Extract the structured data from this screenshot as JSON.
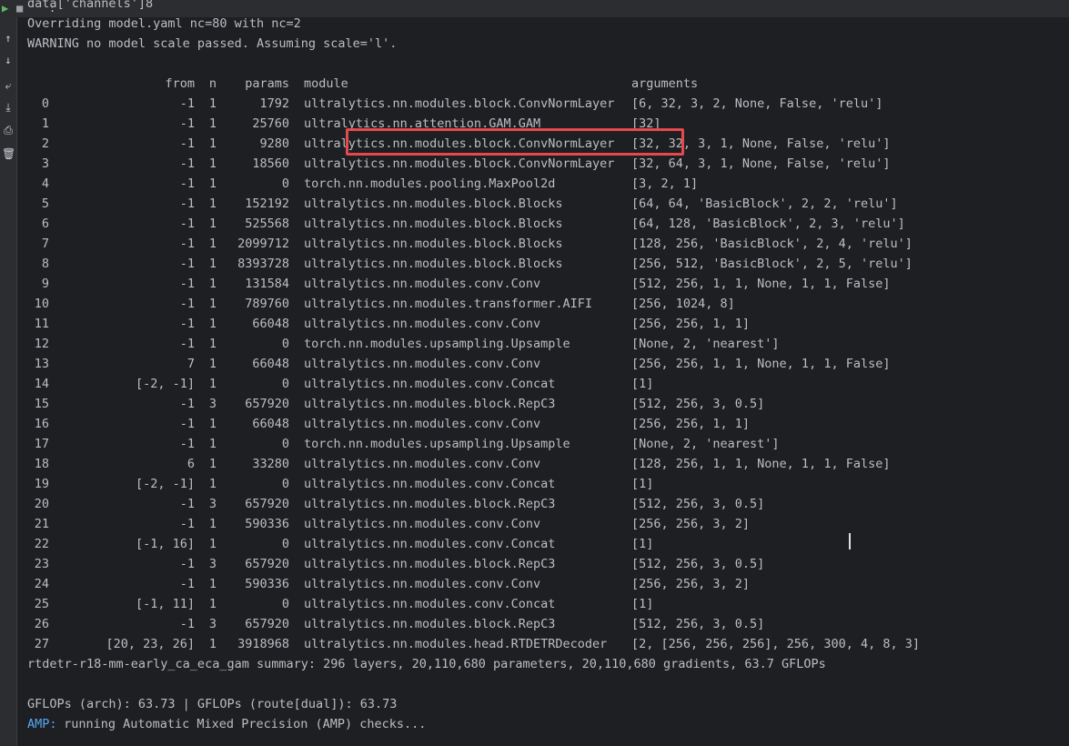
{
  "toolbar": {
    "run_icon": "run-icon",
    "stop_icon": "stop-icon",
    "menu_text": ":"
  },
  "sidebar": {
    "icons": [
      "arrow-up-icon",
      "arrow-down-icon",
      "soft-wrap-icon",
      "scroll-to-end-icon",
      "print-icon",
      "trash-icon"
    ],
    "glyphs": [
      "↑",
      "↓",
      "⤶",
      "⤓",
      "⎙",
      "🗑"
    ]
  },
  "console": {
    "pre_lines": [
      "data['channels']8",
      "Overriding model.yaml nc=80 with nc=2",
      "WARNING no model scale passed. Assuming scale='l'."
    ],
    "table_header": {
      "from": "from",
      "n": "n",
      "params": "params",
      "module": "module",
      "arguments": "arguments"
    },
    "rows": [
      {
        "idx": "0",
        "from": "-1",
        "n": "1",
        "params": "1792",
        "module": "ultralytics.nn.modules.block.ConvNormLayer",
        "arguments": "[6, 32, 3, 2, None, False, 'relu']"
      },
      {
        "idx": "1",
        "from": "-1",
        "n": "1",
        "params": "25760",
        "module": "ultralytics.nn.attention.GAM.GAM",
        "arguments": "[32]"
      },
      {
        "idx": "2",
        "from": "-1",
        "n": "1",
        "params": "9280",
        "module": "ultralytics.nn.modules.block.ConvNormLayer",
        "arguments": "[32, 32, 3, 1, None, False, 'relu']"
      },
      {
        "idx": "3",
        "from": "-1",
        "n": "1",
        "params": "18560",
        "module": "ultralytics.nn.modules.block.ConvNormLayer",
        "arguments": "[32, 64, 3, 1, None, False, 'relu']"
      },
      {
        "idx": "4",
        "from": "-1",
        "n": "1",
        "params": "0",
        "module": "torch.nn.modules.pooling.MaxPool2d",
        "arguments": "[3, 2, 1]"
      },
      {
        "idx": "5",
        "from": "-1",
        "n": "1",
        "params": "152192",
        "module": "ultralytics.nn.modules.block.Blocks",
        "arguments": "[64, 64, 'BasicBlock', 2, 2, 'relu']"
      },
      {
        "idx": "6",
        "from": "-1",
        "n": "1",
        "params": "525568",
        "module": "ultralytics.nn.modules.block.Blocks",
        "arguments": "[64, 128, 'BasicBlock', 2, 3, 'relu']"
      },
      {
        "idx": "7",
        "from": "-1",
        "n": "1",
        "params": "2099712",
        "module": "ultralytics.nn.modules.block.Blocks",
        "arguments": "[128, 256, 'BasicBlock', 2, 4, 'relu']"
      },
      {
        "idx": "8",
        "from": "-1",
        "n": "1",
        "params": "8393728",
        "module": "ultralytics.nn.modules.block.Blocks",
        "arguments": "[256, 512, 'BasicBlock', 2, 5, 'relu']"
      },
      {
        "idx": "9",
        "from": "-1",
        "n": "1",
        "params": "131584",
        "module": "ultralytics.nn.modules.conv.Conv",
        "arguments": "[512, 256, 1, 1, None, 1, 1, False]"
      },
      {
        "idx": "10",
        "from": "-1",
        "n": "1",
        "params": "789760",
        "module": "ultralytics.nn.modules.transformer.AIFI",
        "arguments": "[256, 1024, 8]"
      },
      {
        "idx": "11",
        "from": "-1",
        "n": "1",
        "params": "66048",
        "module": "ultralytics.nn.modules.conv.Conv",
        "arguments": "[256, 256, 1, 1]"
      },
      {
        "idx": "12",
        "from": "-1",
        "n": "1",
        "params": "0",
        "module": "torch.nn.modules.upsampling.Upsample",
        "arguments": "[None, 2, 'nearest']"
      },
      {
        "idx": "13",
        "from": "7",
        "n": "1",
        "params": "66048",
        "module": "ultralytics.nn.modules.conv.Conv",
        "arguments": "[256, 256, 1, 1, None, 1, 1, False]"
      },
      {
        "idx": "14",
        "from": "[-2, -1]",
        "n": "1",
        "params": "0",
        "module": "ultralytics.nn.modules.conv.Concat",
        "arguments": "[1]"
      },
      {
        "idx": "15",
        "from": "-1",
        "n": "3",
        "params": "657920",
        "module": "ultralytics.nn.modules.block.RepC3",
        "arguments": "[512, 256, 3, 0.5]"
      },
      {
        "idx": "16",
        "from": "-1",
        "n": "1",
        "params": "66048",
        "module": "ultralytics.nn.modules.conv.Conv",
        "arguments": "[256, 256, 1, 1]"
      },
      {
        "idx": "17",
        "from": "-1",
        "n": "1",
        "params": "0",
        "module": "torch.nn.modules.upsampling.Upsample",
        "arguments": "[None, 2, 'nearest']"
      },
      {
        "idx": "18",
        "from": "6",
        "n": "1",
        "params": "33280",
        "module": "ultralytics.nn.modules.conv.Conv",
        "arguments": "[128, 256, 1, 1, None, 1, 1, False]"
      },
      {
        "idx": "19",
        "from": "[-2, -1]",
        "n": "1",
        "params": "0",
        "module": "ultralytics.nn.modules.conv.Concat",
        "arguments": "[1]"
      },
      {
        "idx": "20",
        "from": "-1",
        "n": "3",
        "params": "657920",
        "module": "ultralytics.nn.modules.block.RepC3",
        "arguments": "[512, 256, 3, 0.5]"
      },
      {
        "idx": "21",
        "from": "-1",
        "n": "1",
        "params": "590336",
        "module": "ultralytics.nn.modules.conv.Conv",
        "arguments": "[256, 256, 3, 2]"
      },
      {
        "idx": "22",
        "from": "[-1, 16]",
        "n": "1",
        "params": "0",
        "module": "ultralytics.nn.modules.conv.Concat",
        "arguments": "[1]"
      },
      {
        "idx": "23",
        "from": "-1",
        "n": "3",
        "params": "657920",
        "module": "ultralytics.nn.modules.block.RepC3",
        "arguments": "[512, 256, 3, 0.5]"
      },
      {
        "idx": "24",
        "from": "-1",
        "n": "1",
        "params": "590336",
        "module": "ultralytics.nn.modules.conv.Conv",
        "arguments": "[256, 256, 3, 2]"
      },
      {
        "idx": "25",
        "from": "[-1, 11]",
        "n": "1",
        "params": "0",
        "module": "ultralytics.nn.modules.conv.Concat",
        "arguments": "[1]"
      },
      {
        "idx": "26",
        "from": "-1",
        "n": "3",
        "params": "657920",
        "module": "ultralytics.nn.modules.block.RepC3",
        "arguments": "[512, 256, 3, 0.5]"
      },
      {
        "idx": "27",
        "from": "[20, 23, 26]",
        "n": "1",
        "params": "3918968",
        "module": "ultralytics.nn.modules.head.RTDETRDecoder",
        "arguments": "[2, [256, 256, 256], 256, 300, 4, 8, 3]"
      }
    ],
    "summary": "rtdetr-r18-mm-early_ca_eca_gam summary: 296 layers, 20,110,680 parameters, 20,110,680 gradients, 63.7 GFLOPs",
    "gflops": "GFLOPs (arch): 63.73 | GFLOPs (route[dual]): 63.73",
    "amp_label": "AMP:",
    "amp_text": " running Automatic Mixed Precision (AMP) checks..."
  },
  "colors": {
    "background": "#1e1f22",
    "text": "#bcbec4",
    "highlight_border": "#e5484d",
    "amp_blue": "#56a8f5",
    "run_green": "#5fb865"
  }
}
